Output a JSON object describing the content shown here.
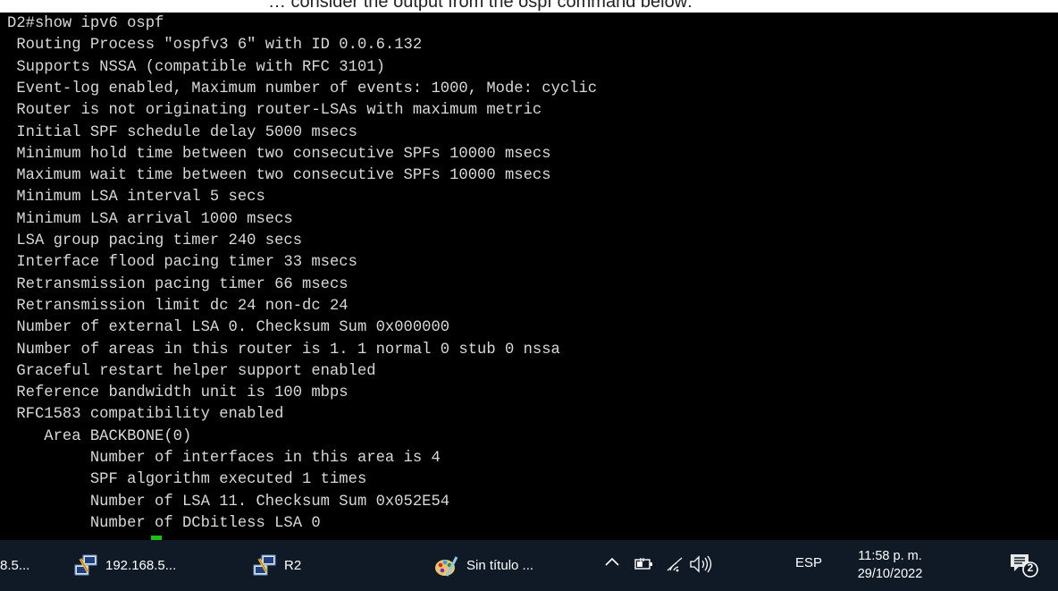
{
  "top_caption": "… consider the output from the ospf command below:",
  "terminal": {
    "lines": [
      "D2#show ipv6 ospf",
      " Routing Process \"ospfv3 6\" with ID 0.0.6.132",
      " Supports NSSA (compatible with RFC 3101)",
      " Event-log enabled, Maximum number of events: 1000, Mode: cyclic",
      " Router is not originating router-LSAs with maximum metric",
      " Initial SPF schedule delay 5000 msecs",
      " Minimum hold time between two consecutive SPFs 10000 msecs",
      " Maximum wait time between two consecutive SPFs 10000 msecs",
      " Minimum LSA interval 5 secs",
      " Minimum LSA arrival 1000 msecs",
      " LSA group pacing timer 240 secs",
      " Interface flood pacing timer 33 msecs",
      " Retransmission pacing timer 66 msecs",
      " Retransmission limit dc 24 non-dc 24",
      " Number of external LSA 0. Checksum Sum 0x000000",
      " Number of areas in this router is 1. 1 normal 0 stub 0 nssa",
      " Graceful restart helper support enabled",
      " Reference bandwidth unit is 100 mbps",
      " RFC1583 compatibility enabled",
      "    Area BACKBONE(0)",
      "         Number of interfaces in this area is 4",
      "         SPF algorithm executed 1 times",
      "         Number of LSA 11. Checksum Sum 0x052E54",
      "         Number of DCbitless LSA 0"
    ]
  },
  "taskbar": {
    "tasks": [
      {
        "label": "8.5...",
        "icon": "putty-icon"
      },
      {
        "label": "192.168.5...",
        "icon": "putty-icon"
      },
      {
        "label": "R2",
        "icon": "putty-icon"
      },
      {
        "label": "Sin título ...",
        "icon": "paint-icon"
      }
    ],
    "tray": {
      "chevron": "^",
      "icons": [
        "battery-icon",
        "wifi-icon",
        "volume-icon"
      ],
      "language": "ESP",
      "time": "11:58 p. m.",
      "date": "29/10/2022",
      "notifications_count": "2"
    }
  },
  "colors": {
    "terminal_bg": "#000000",
    "terminal_text": "#d8d8d8",
    "cursor": "#17c217",
    "taskbar_bg": "#101a27"
  }
}
